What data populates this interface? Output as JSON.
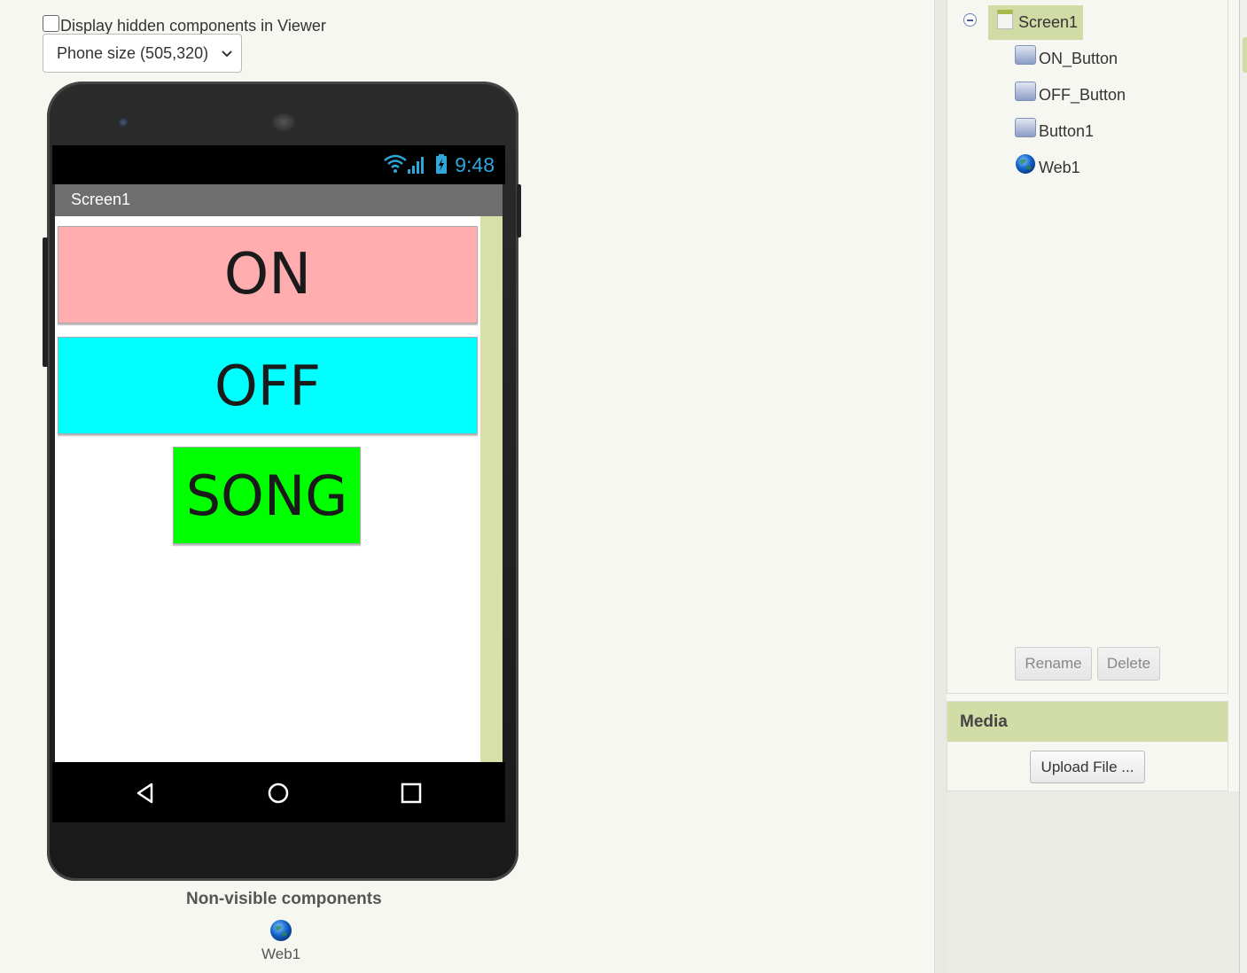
{
  "viewer": {
    "hidden_components_label": "Display hidden components in Viewer",
    "size_select_value": "Phone size (505,320)"
  },
  "phone": {
    "status_time": "9:48",
    "screen_title": "Screen1",
    "buttons": {
      "on": "ON",
      "off": "OFF",
      "song": "SONG"
    },
    "colors": {
      "on_bg": "#ffadaf",
      "off_bg": "#00ffff",
      "song_bg": "#00ff00"
    }
  },
  "nonvisible": {
    "title": "Non-visible components",
    "items": [
      "Web1"
    ]
  },
  "components": {
    "root": "Screen1",
    "items": [
      "ON_Button",
      "OFF_Button",
      "Button1",
      "Web1"
    ],
    "rename_label": "Rename",
    "delete_label": "Delete"
  },
  "media": {
    "title": "Media",
    "upload_label": "Upload File ..."
  }
}
